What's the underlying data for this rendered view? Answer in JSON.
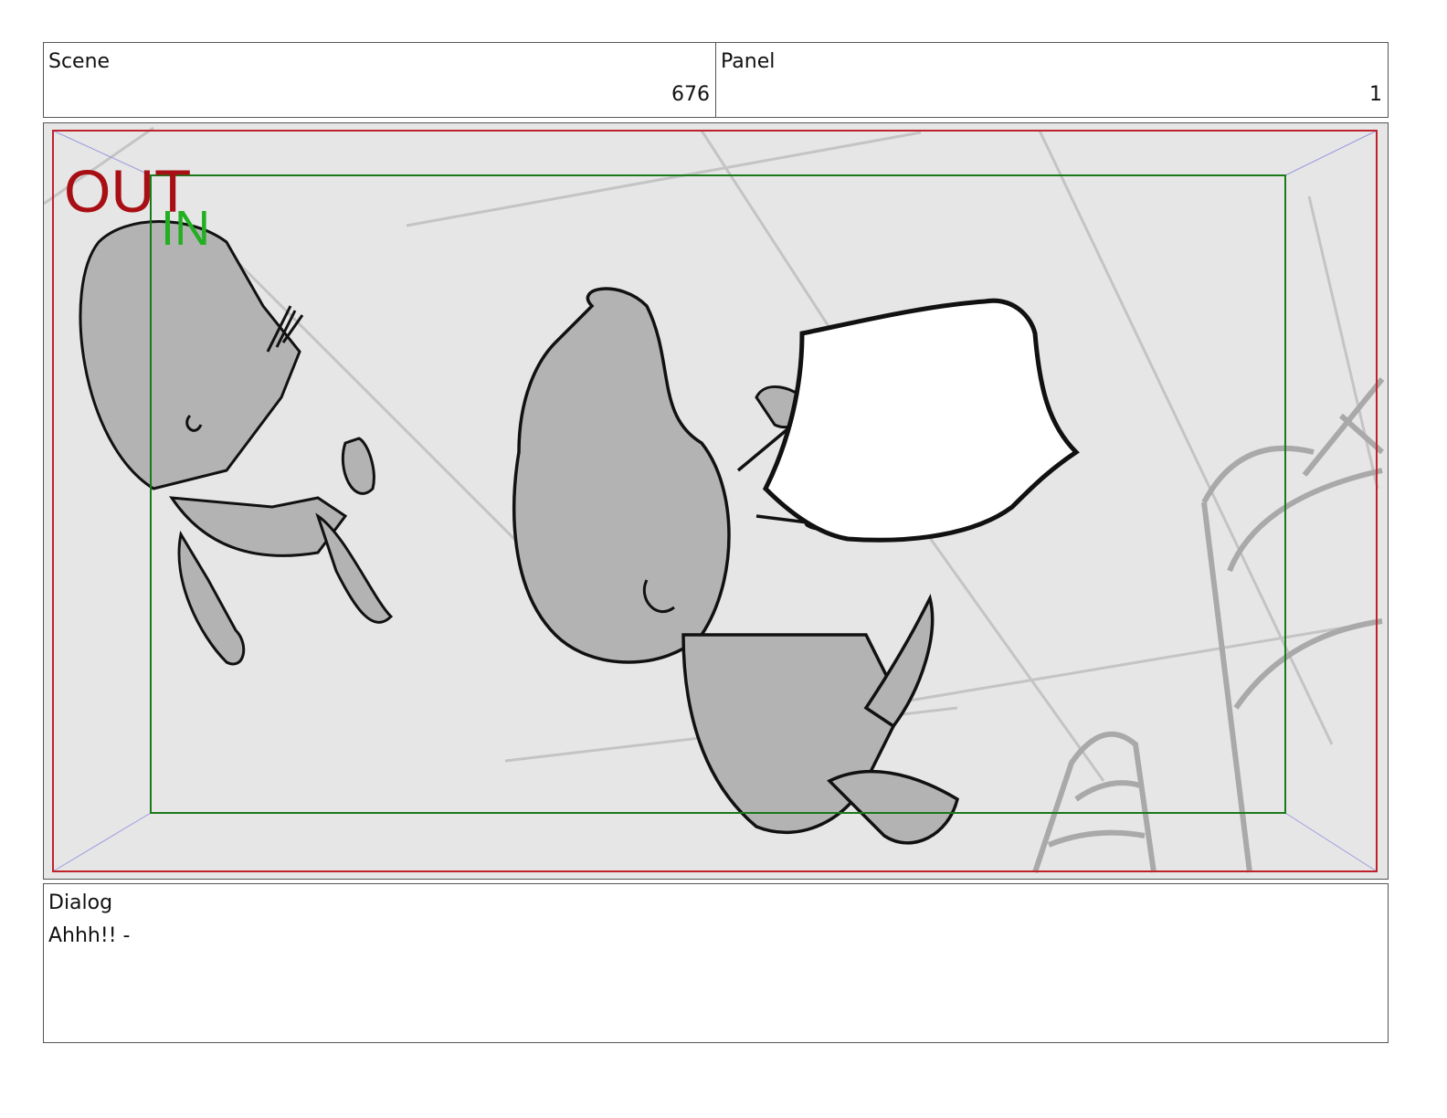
{
  "header": {
    "scene_label": "Scene",
    "scene_value": "676",
    "panel_label": "Panel",
    "panel_value": "1"
  },
  "frame": {
    "out_label": "OUT",
    "in_label": "IN",
    "colors": {
      "out_border": "#c0222a",
      "in_border": "#1a7a1a",
      "out_text": "#a80f14",
      "in_text": "#22b022",
      "background": "#e6e6e6",
      "sketch_gray": "#b3b3b3",
      "ink": "#111111"
    }
  },
  "dialog": {
    "label": "Dialog",
    "text": "Ahhh!! -"
  }
}
